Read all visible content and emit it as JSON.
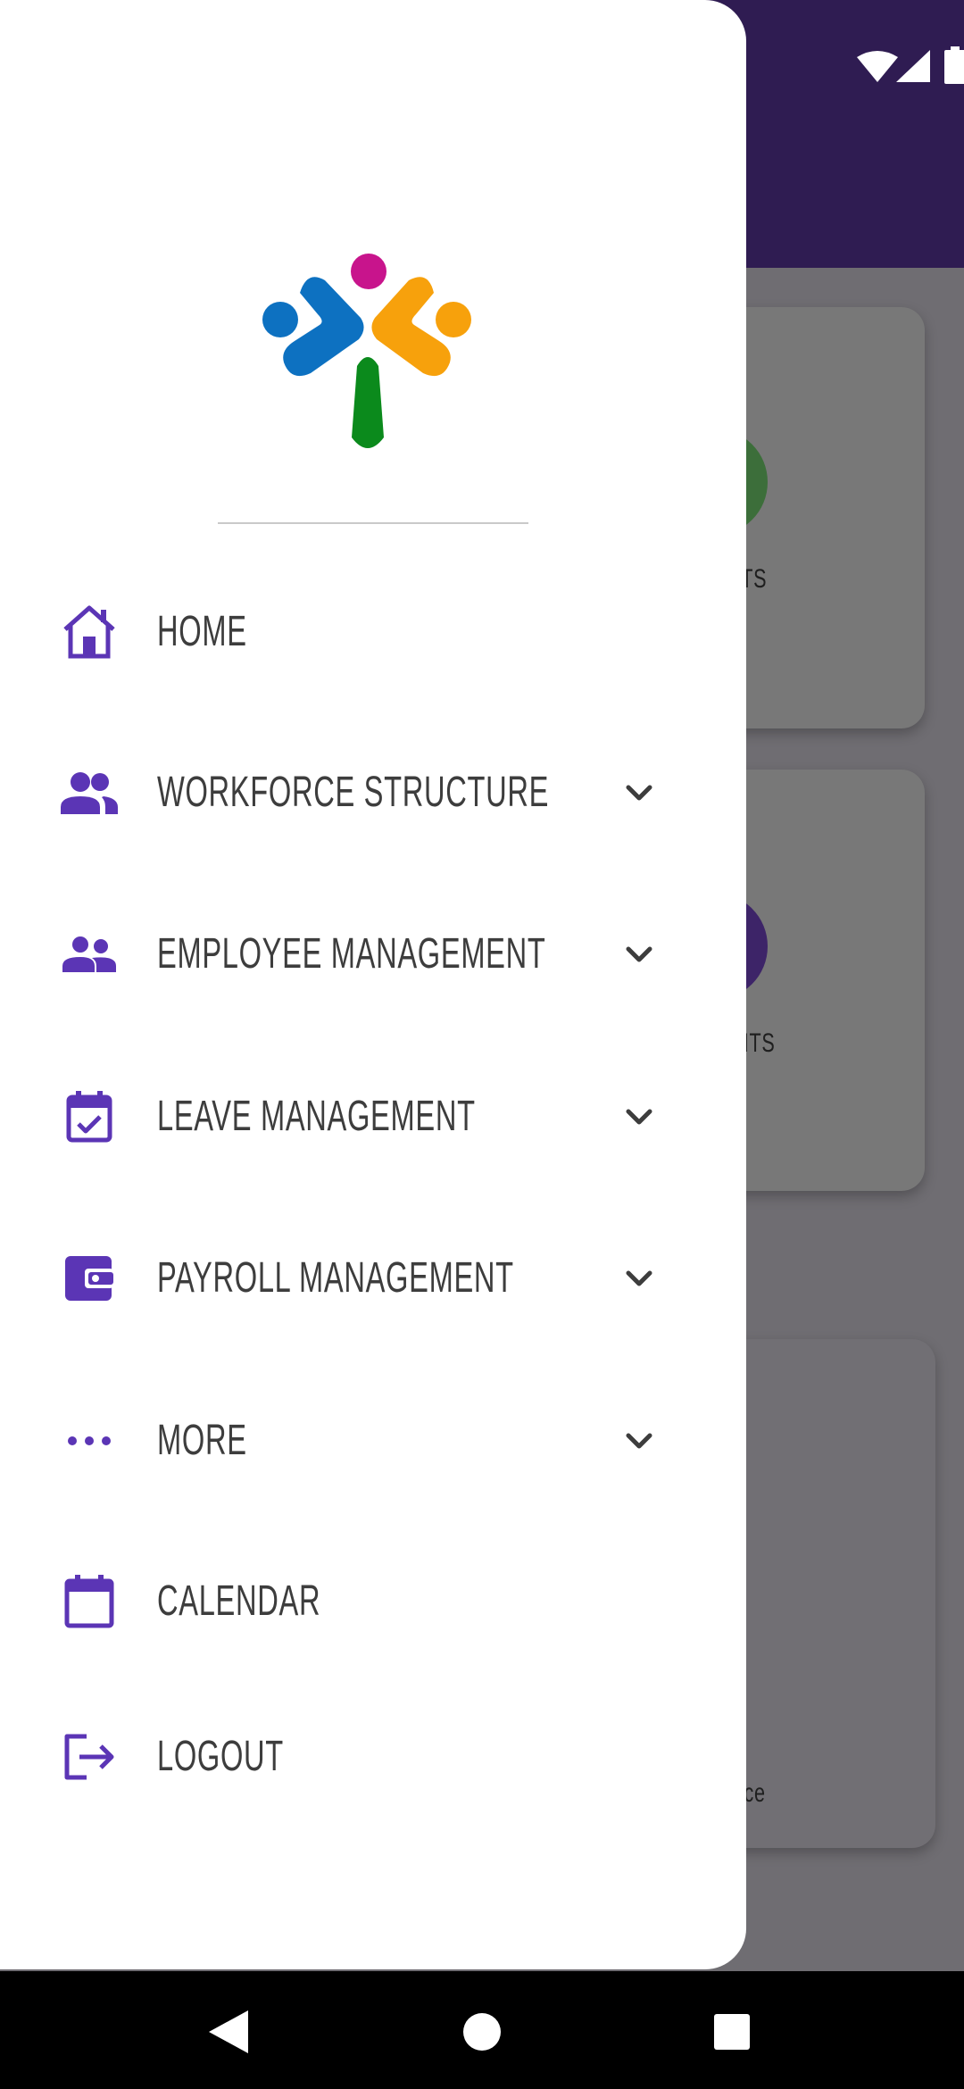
{
  "colors": {
    "accent": "#5b35b5",
    "header": "#2f1c52",
    "drawer_bg": "#ffffff",
    "menu_text": "#3d3d3d",
    "scrim": "#6f6d72"
  },
  "background_app": {
    "cards": [
      {
        "label": "ESTS"
      },
      {
        "label": "ENTS"
      },
      {
        "label": "ance"
      }
    ]
  },
  "drawer": {
    "logo": "app-logo",
    "menu": [
      {
        "label": "HOME",
        "icon": "home-icon",
        "expandable": false
      },
      {
        "label": "WORKFORCE STRUCTURE",
        "icon": "group-icon",
        "expandable": true
      },
      {
        "label": "EMPLOYEE MANAGEMENT",
        "icon": "people-icon",
        "expandable": true
      },
      {
        "label": "LEAVE MANAGEMENT",
        "icon": "event-available-icon",
        "expandable": true
      },
      {
        "label": "PAYROLL MANAGEMENT",
        "icon": "wallet-icon",
        "expandable": true
      },
      {
        "label": "MORE",
        "icon": "more-horizontal-icon",
        "expandable": true
      },
      {
        "label": "CALENDAR",
        "icon": "calendar-icon",
        "expandable": false
      },
      {
        "label": "LOGOUT",
        "icon": "logout-icon",
        "expandable": false
      }
    ]
  },
  "status_bar": {
    "icons": [
      "wifi-icon",
      "signal-icon",
      "battery-icon"
    ]
  },
  "nav_bar": {
    "buttons": [
      "back-icon",
      "home-circle-icon",
      "recents-icon"
    ]
  }
}
